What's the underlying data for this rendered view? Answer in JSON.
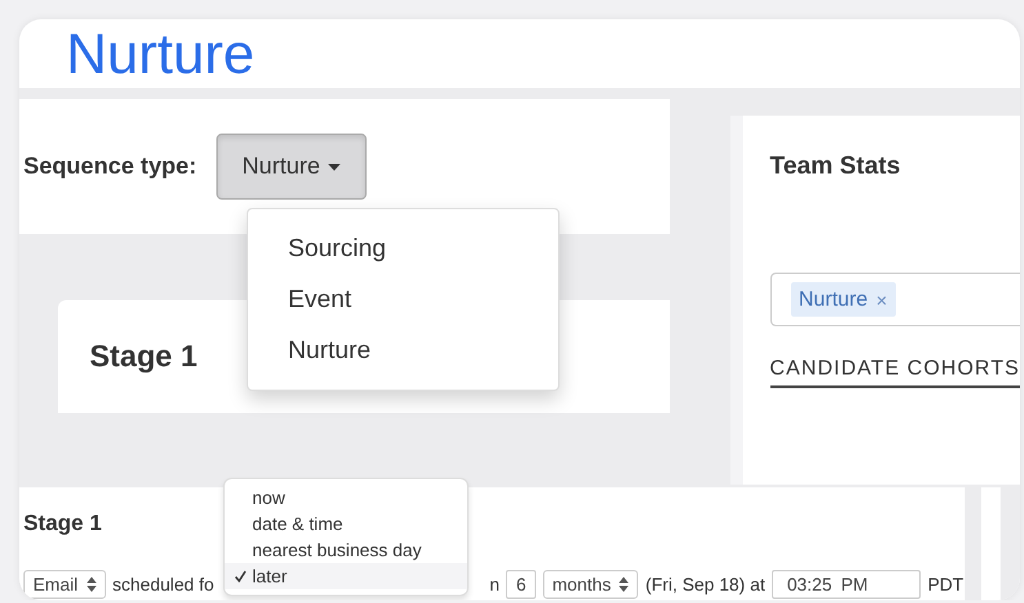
{
  "title": "Nurture",
  "sequence_type": {
    "label": "Sequence type:",
    "value": "Nurture",
    "expanded": true,
    "options": [
      {
        "label": "Sourcing"
      },
      {
        "label": "Event"
      },
      {
        "label": "Nurture"
      }
    ]
  },
  "stage_card": {
    "title": "Stage 1"
  },
  "team_stats": {
    "title": "Team Stats",
    "tags": [
      {
        "label": "Nurture",
        "remove": "×"
      }
    ],
    "tab": {
      "label": "CANDIDATE COHORTS",
      "selected": true
    }
  },
  "stage": {
    "title": "Stage 1",
    "channel": "Email",
    "text_before": "scheduled fo",
    "text_after": "n",
    "amount": "6",
    "unit": "months",
    "date_text": "(Fri, Sep 18) at",
    "time": "03:25 PM",
    "zone": "PDT",
    "timing_menu": [
      {
        "label": "now",
        "selected": false
      },
      {
        "label": "date & time",
        "selected": false
      },
      {
        "label": "nearest business day",
        "selected": false
      },
      {
        "label": "later",
        "selected": true
      }
    ]
  }
}
